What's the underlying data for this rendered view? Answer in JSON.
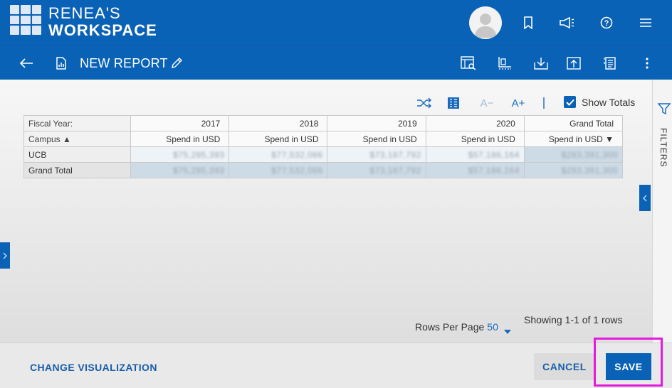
{
  "app": {
    "brand_line1": "RENEA'S",
    "brand_line2": "WORKSPACE"
  },
  "report": {
    "title": "NEW REPORT"
  },
  "toolbar": {
    "decrease_font": "A−",
    "increase_font": "A+",
    "show_totals_label": "Show Totals",
    "show_totals_checked": true
  },
  "table": {
    "row_header_label": "Fiscal Year:",
    "campus_label": "Campus ▲",
    "years": [
      "2017",
      "2018",
      "2019",
      "2020",
      "Grand Total"
    ],
    "measure": "Spend in USD",
    "measure_sorted": "Spend in USD ▼",
    "rows": [
      {
        "label": "UCB",
        "values": [
          "$75,285,393",
          "$77,532,066",
          "$73,187,792",
          "$57,186,164",
          "$283,391,300"
        ]
      },
      {
        "label": "Grand Total",
        "values": [
          "$75,285,393",
          "$77,532,066",
          "$73,187,792",
          "$57,186,164",
          "$283,391,300"
        ]
      }
    ]
  },
  "pagination": {
    "rows_per_page_label": "Rows Per Page",
    "rows_per_page_value": "50",
    "showing_text": "Showing 1-1 of 1 rows"
  },
  "sidebar": {
    "filters_label": "FILTERS"
  },
  "footer": {
    "change_visualization": "CHANGE VISUALIZATION",
    "cancel": "CANCEL",
    "save": "SAVE"
  },
  "colors": {
    "brand_blue": "#0a62b6",
    "highlight": "#e51adf"
  }
}
